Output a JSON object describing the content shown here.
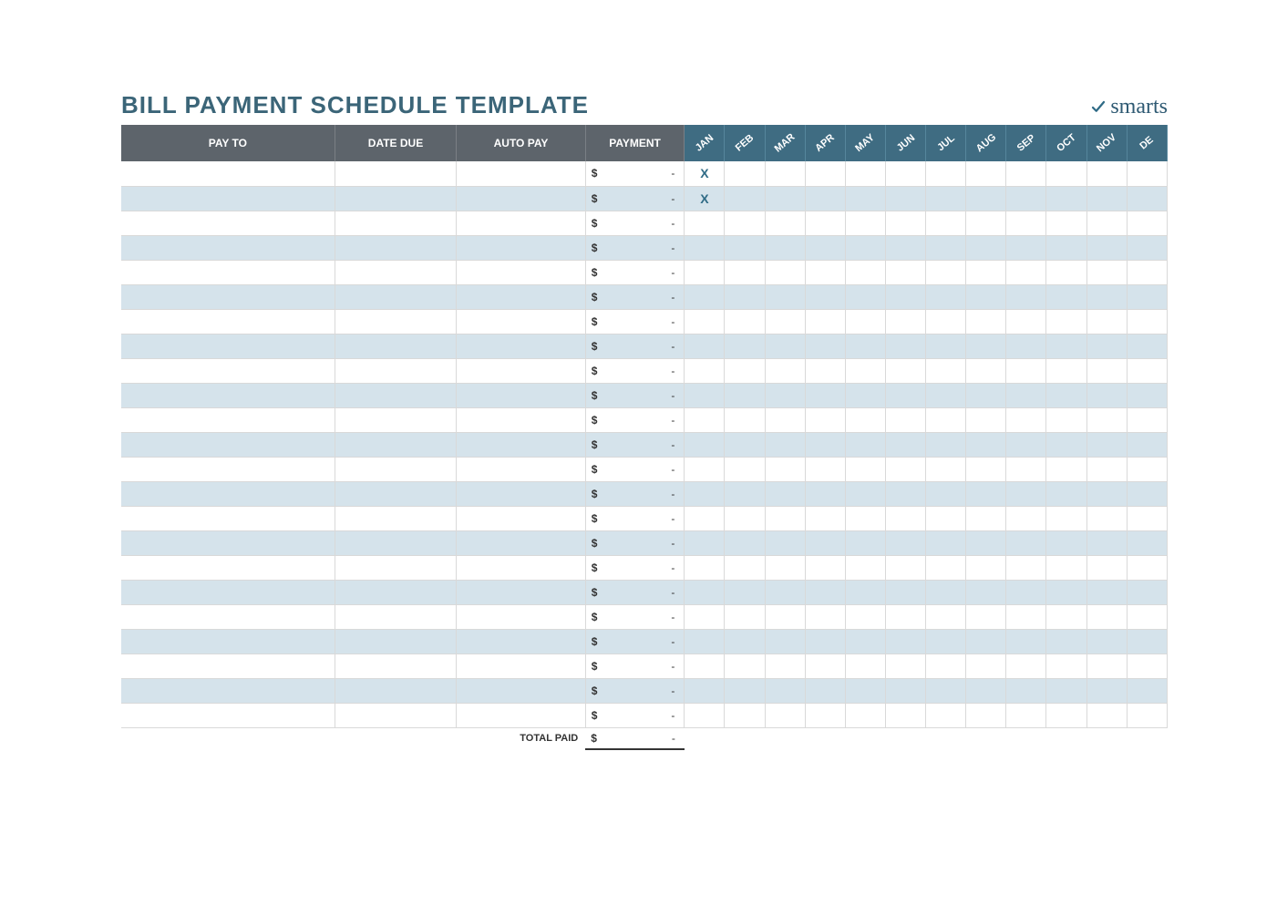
{
  "title": "BILL PAYMENT SCHEDULE TEMPLATE",
  "logo_text": "smarts",
  "columns": {
    "pay_to": "PAY TO",
    "date_due": "DATE DUE",
    "auto_pay": "AUTO PAY",
    "payment": "PAYMENT"
  },
  "months": [
    "JAN",
    "FEB",
    "MAR",
    "APR",
    "MAY",
    "JUN",
    "JUL",
    "AUG",
    "SEP",
    "OCT",
    "NOV",
    "DE"
  ],
  "currency_symbol": "$",
  "empty_value": "-",
  "mark_symbol": "X",
  "total_label": "TOTAL PAID",
  "total_value": "-",
  "rows": [
    {
      "pay_to": "",
      "date_due": "",
      "auto_pay": "",
      "payment": "-",
      "marks": [
        true,
        false,
        false,
        false,
        false,
        false,
        false,
        false,
        false,
        false,
        false,
        false
      ]
    },
    {
      "pay_to": "",
      "date_due": "",
      "auto_pay": "",
      "payment": "-",
      "marks": [
        true,
        false,
        false,
        false,
        false,
        false,
        false,
        false,
        false,
        false,
        false,
        false
      ]
    },
    {
      "pay_to": "",
      "date_due": "",
      "auto_pay": "",
      "payment": "-",
      "marks": [
        false,
        false,
        false,
        false,
        false,
        false,
        false,
        false,
        false,
        false,
        false,
        false
      ]
    },
    {
      "pay_to": "",
      "date_due": "",
      "auto_pay": "",
      "payment": "-",
      "marks": [
        false,
        false,
        false,
        false,
        false,
        false,
        false,
        false,
        false,
        false,
        false,
        false
      ]
    },
    {
      "pay_to": "",
      "date_due": "",
      "auto_pay": "",
      "payment": "-",
      "marks": [
        false,
        false,
        false,
        false,
        false,
        false,
        false,
        false,
        false,
        false,
        false,
        false
      ]
    },
    {
      "pay_to": "",
      "date_due": "",
      "auto_pay": "",
      "payment": "-",
      "marks": [
        false,
        false,
        false,
        false,
        false,
        false,
        false,
        false,
        false,
        false,
        false,
        false
      ]
    },
    {
      "pay_to": "",
      "date_due": "",
      "auto_pay": "",
      "payment": "-",
      "marks": [
        false,
        false,
        false,
        false,
        false,
        false,
        false,
        false,
        false,
        false,
        false,
        false
      ]
    },
    {
      "pay_to": "",
      "date_due": "",
      "auto_pay": "",
      "payment": "-",
      "marks": [
        false,
        false,
        false,
        false,
        false,
        false,
        false,
        false,
        false,
        false,
        false,
        false
      ]
    },
    {
      "pay_to": "",
      "date_due": "",
      "auto_pay": "",
      "payment": "-",
      "marks": [
        false,
        false,
        false,
        false,
        false,
        false,
        false,
        false,
        false,
        false,
        false,
        false
      ]
    },
    {
      "pay_to": "",
      "date_due": "",
      "auto_pay": "",
      "payment": "-",
      "marks": [
        false,
        false,
        false,
        false,
        false,
        false,
        false,
        false,
        false,
        false,
        false,
        false
      ]
    },
    {
      "pay_to": "",
      "date_due": "",
      "auto_pay": "",
      "payment": "-",
      "marks": [
        false,
        false,
        false,
        false,
        false,
        false,
        false,
        false,
        false,
        false,
        false,
        false
      ]
    },
    {
      "pay_to": "",
      "date_due": "",
      "auto_pay": "",
      "payment": "-",
      "marks": [
        false,
        false,
        false,
        false,
        false,
        false,
        false,
        false,
        false,
        false,
        false,
        false
      ]
    },
    {
      "pay_to": "",
      "date_due": "",
      "auto_pay": "",
      "payment": "-",
      "marks": [
        false,
        false,
        false,
        false,
        false,
        false,
        false,
        false,
        false,
        false,
        false,
        false
      ]
    },
    {
      "pay_to": "",
      "date_due": "",
      "auto_pay": "",
      "payment": "-",
      "marks": [
        false,
        false,
        false,
        false,
        false,
        false,
        false,
        false,
        false,
        false,
        false,
        false
      ]
    },
    {
      "pay_to": "",
      "date_due": "",
      "auto_pay": "",
      "payment": "-",
      "marks": [
        false,
        false,
        false,
        false,
        false,
        false,
        false,
        false,
        false,
        false,
        false,
        false
      ]
    },
    {
      "pay_to": "",
      "date_due": "",
      "auto_pay": "",
      "payment": "-",
      "marks": [
        false,
        false,
        false,
        false,
        false,
        false,
        false,
        false,
        false,
        false,
        false,
        false
      ]
    },
    {
      "pay_to": "",
      "date_due": "",
      "auto_pay": "",
      "payment": "-",
      "marks": [
        false,
        false,
        false,
        false,
        false,
        false,
        false,
        false,
        false,
        false,
        false,
        false
      ]
    },
    {
      "pay_to": "",
      "date_due": "",
      "auto_pay": "",
      "payment": "-",
      "marks": [
        false,
        false,
        false,
        false,
        false,
        false,
        false,
        false,
        false,
        false,
        false,
        false
      ]
    },
    {
      "pay_to": "",
      "date_due": "",
      "auto_pay": "",
      "payment": "-",
      "marks": [
        false,
        false,
        false,
        false,
        false,
        false,
        false,
        false,
        false,
        false,
        false,
        false
      ]
    },
    {
      "pay_to": "",
      "date_due": "",
      "auto_pay": "",
      "payment": "-",
      "marks": [
        false,
        false,
        false,
        false,
        false,
        false,
        false,
        false,
        false,
        false,
        false,
        false
      ]
    },
    {
      "pay_to": "",
      "date_due": "",
      "auto_pay": "",
      "payment": "-",
      "marks": [
        false,
        false,
        false,
        false,
        false,
        false,
        false,
        false,
        false,
        false,
        false,
        false
      ]
    },
    {
      "pay_to": "",
      "date_due": "",
      "auto_pay": "",
      "payment": "-",
      "marks": [
        false,
        false,
        false,
        false,
        false,
        false,
        false,
        false,
        false,
        false,
        false,
        false
      ]
    },
    {
      "pay_to": "",
      "date_due": "",
      "auto_pay": "",
      "payment": "-",
      "marks": [
        false,
        false,
        false,
        false,
        false,
        false,
        false,
        false,
        false,
        false,
        false,
        false
      ]
    }
  ]
}
